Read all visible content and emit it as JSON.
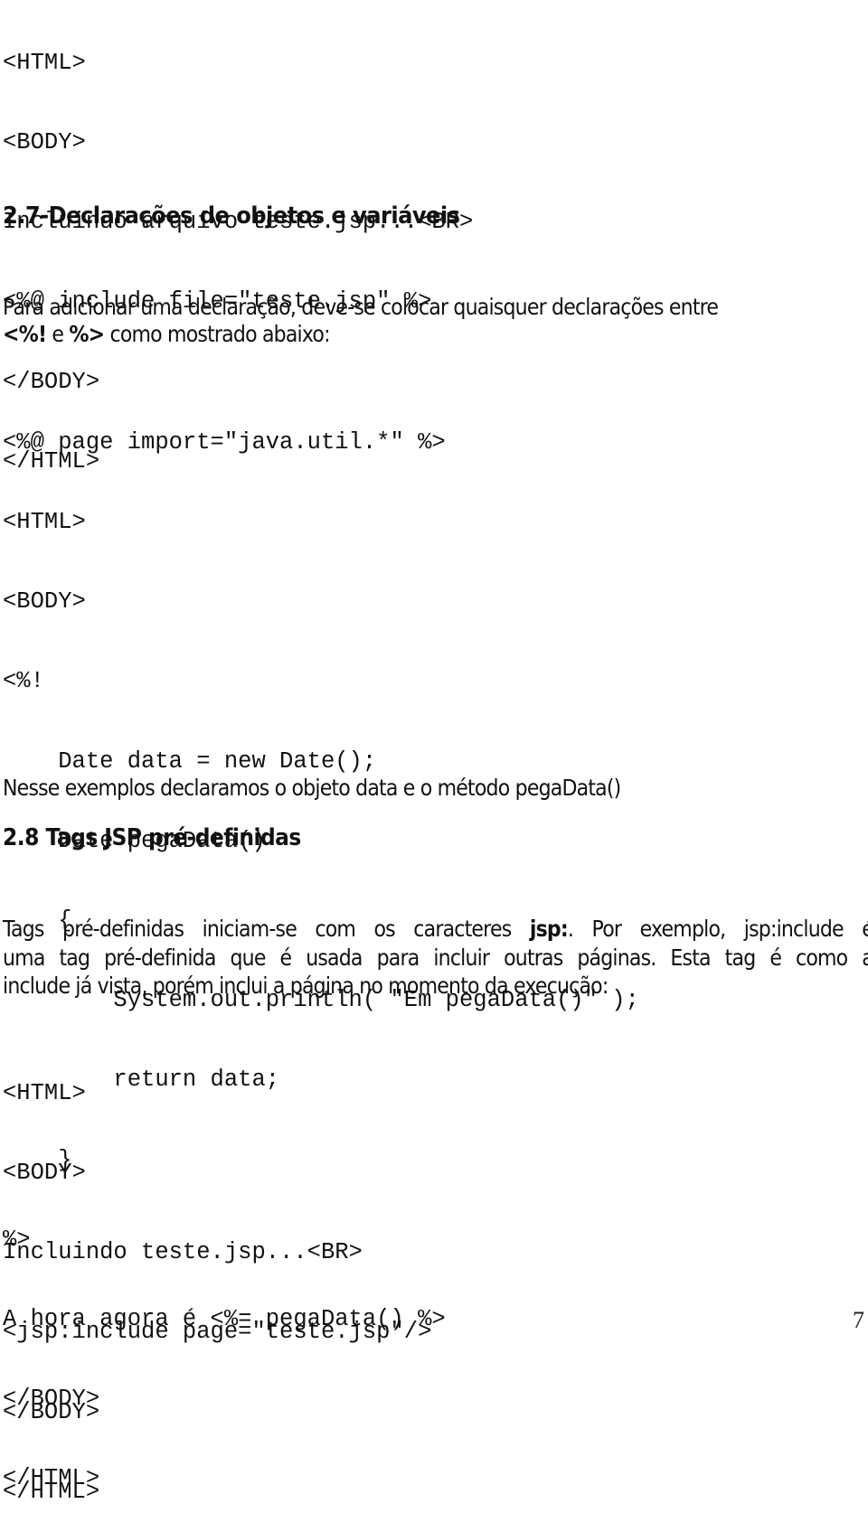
{
  "code_block_1": [
    "<HTML>",
    "<BODY>",
    "Incluindo arquivo teste.jsp...<BR>",
    "<%@ include file=\"teste.jsp\" %>",
    "</BODY>",
    "</HTML>"
  ],
  "section_2_7": {
    "heading": "2.7-Declarações de objetos e variáveis",
    "paragraph_line1": "Para adicionar uma declaração, deve-se colocar quaisquer declarações entre",
    "open_tag": "<%!",
    "connector": " e ",
    "close_tag": "%>",
    "paragraph_tail": " como mostrado abaixo:"
  },
  "code_block_2": [
    "<%@ page import=\"java.util.*\" %>",
    "<HTML>",
    "<BODY>",
    "<%!",
    "    Date data = new Date();",
    "    Date pegaData()",
    "    {",
    "        System.out.println( \"Em pegaData()\" );",
    "        return data;",
    "    }",
    "%>",
    "A hora agora é <%= pegaData() %>",
    "</BODY>",
    "</HTML>"
  ],
  "note_after_code": "Nesse exemplos declaramos o objeto data e o método pegaData()",
  "section_2_8": {
    "heading": "2.8 Tags JSP pré-definidas",
    "line1_pre": "Tags pré-definidas iniciam-se com os caracteres ",
    "line1_bold": "jsp:",
    "line1_post": ".  Por exemplo, jsp:include é",
    "line2": "uma tag pré-definida que é usada para incluir outras páginas. Esta tag é como a",
    "line3": "include já vista, porém inclui a página no momento da execução:"
  },
  "code_block_3": [
    "<HTML>",
    "<BODY>",
    "Incluindo teste.jsp...<BR>",
    "<jsp:include page=\"teste.jsp\"/>",
    "</BODY>",
    "</HTML>"
  ],
  "page_number": "7"
}
